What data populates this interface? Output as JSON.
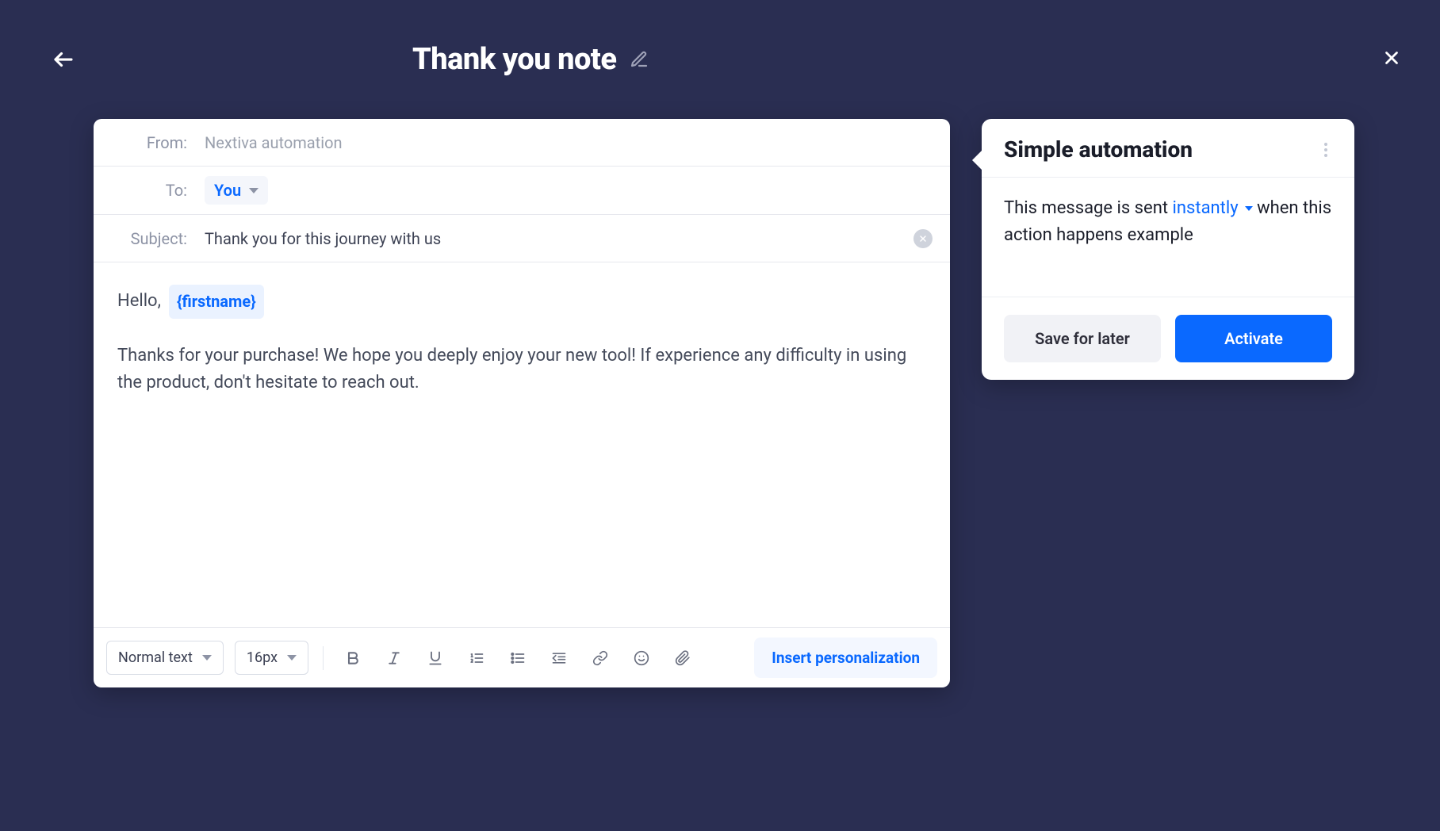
{
  "header": {
    "title": "Thank you note"
  },
  "composer": {
    "from_label": "From:",
    "from_value": "Nextiva automation",
    "to_label": "To:",
    "to_value": "You",
    "subject_label": "Subject:",
    "subject_value": "Thank you for this journey with us",
    "greeting_text": "Hello,",
    "personalization_chip": "{firstname}",
    "body_text": "Thanks for your purchase! We hope you deeply enjoy your new tool! If experience any difficulty in using the product, don't hesitate to reach out."
  },
  "toolbar": {
    "text_style": "Normal text",
    "font_size": "16px",
    "insert_personalization_label": "Insert personalization"
  },
  "side_panel": {
    "title": "Simple automation",
    "desc_part1": "This message is sent",
    "timing": "instantly",
    "desc_part2": "when this action happens example",
    "save_label": "Save for later",
    "activate_label": "Activate"
  }
}
